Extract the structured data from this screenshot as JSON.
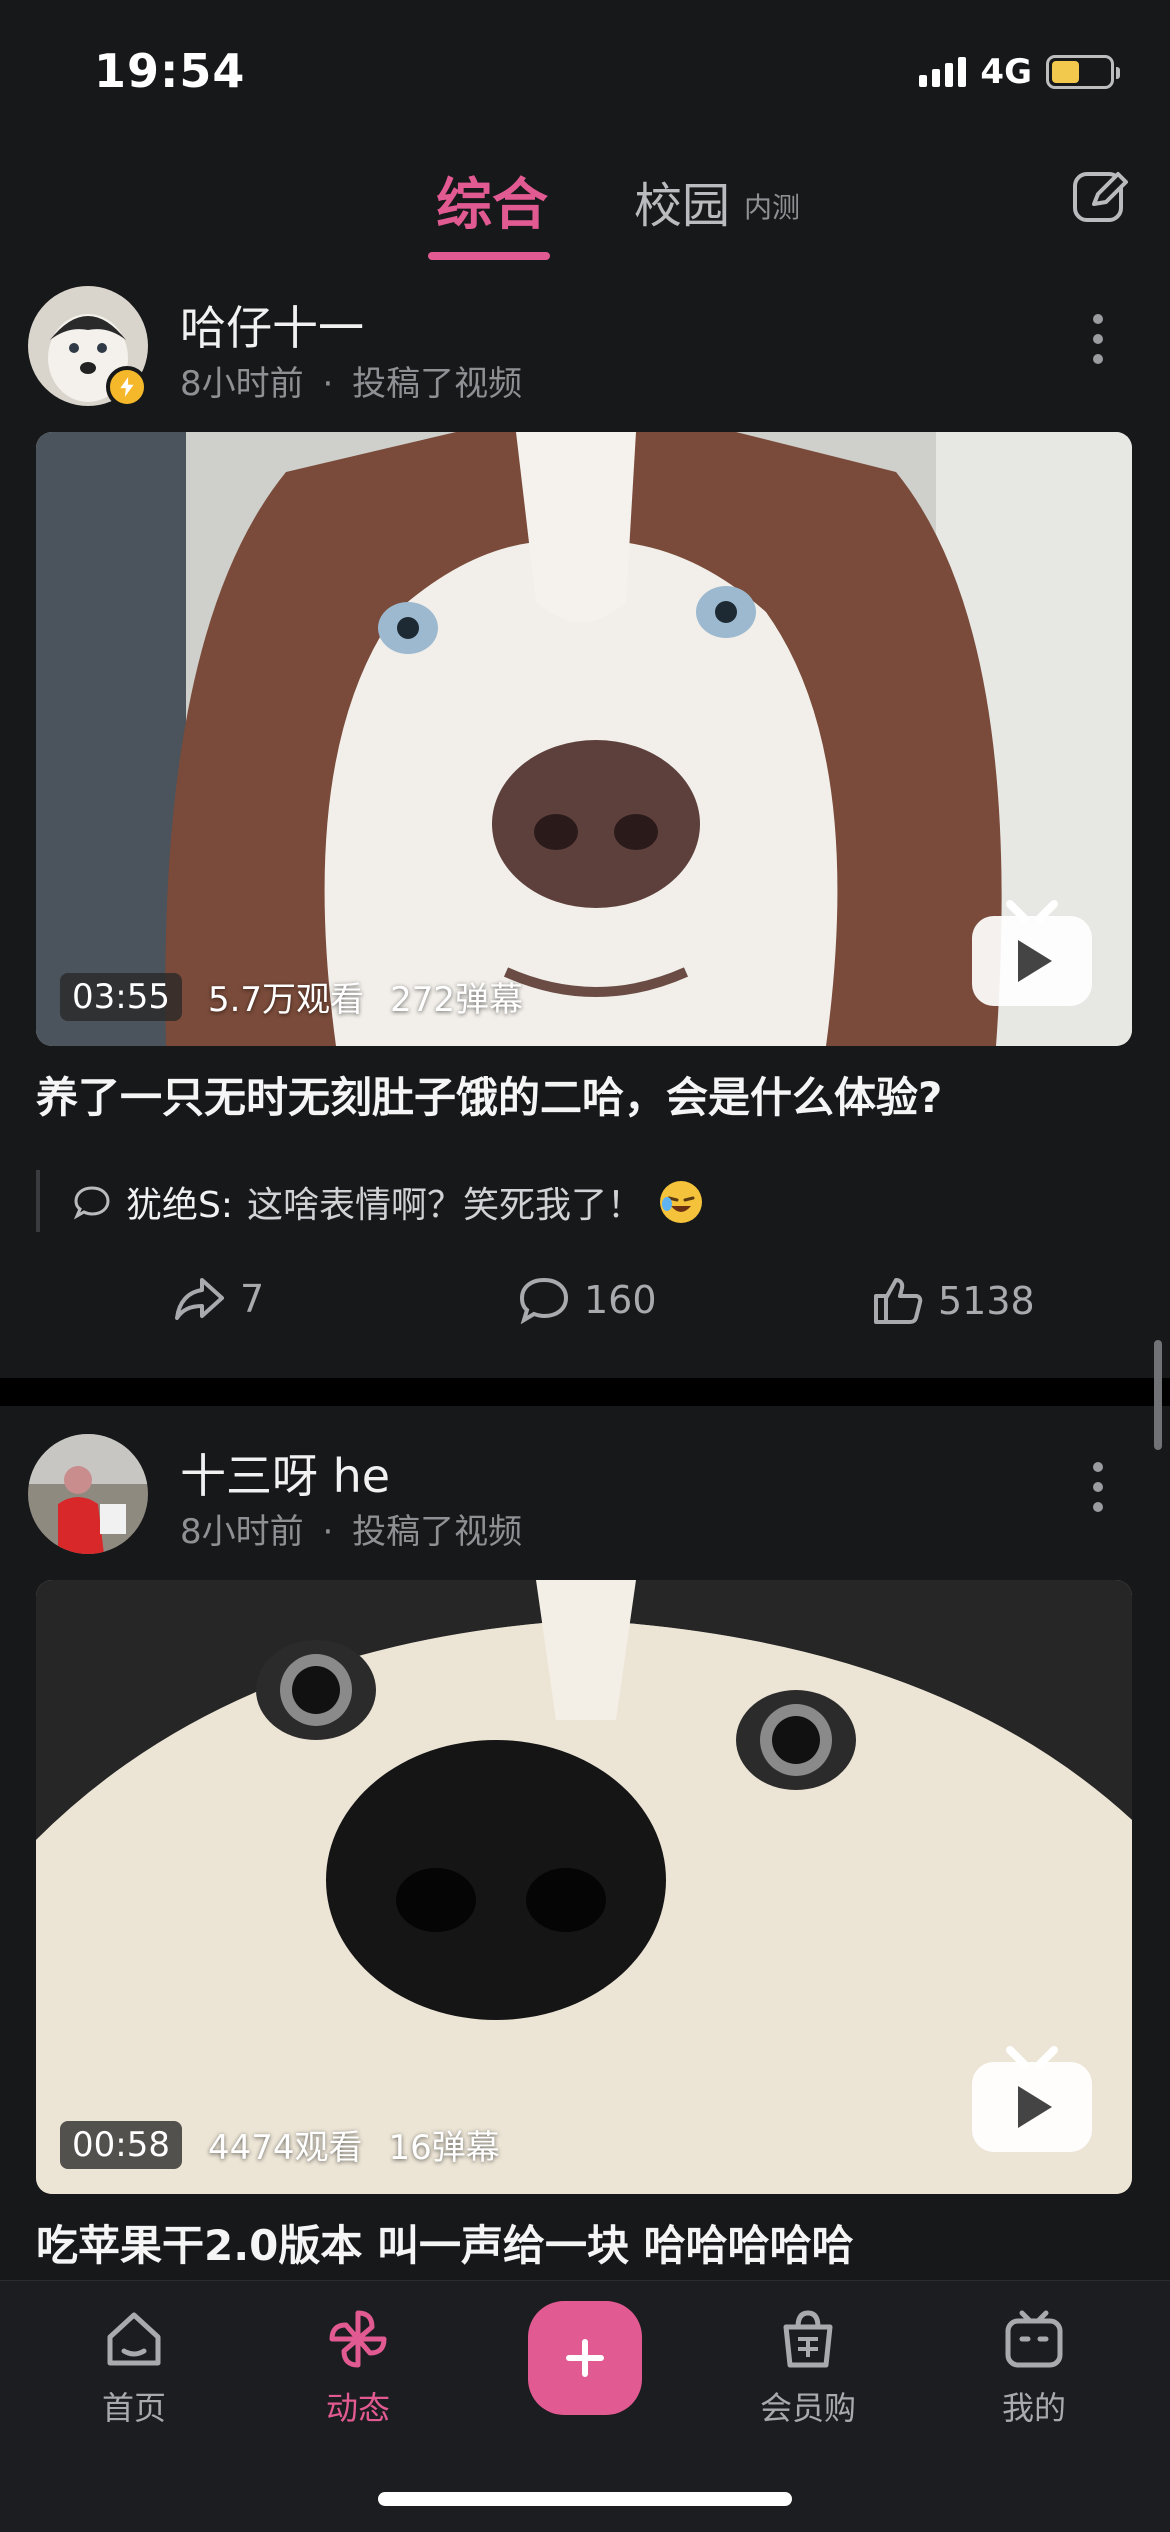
{
  "status_bar": {
    "time": "19:54",
    "network": "4G"
  },
  "top_tabs": {
    "active": "综合",
    "other": "校园",
    "other_badge": "内测"
  },
  "posts": [
    {
      "author": "哈仔十一",
      "time": "8小时前",
      "action": "投稿了视频",
      "duration": "03:55",
      "views": "5.7万观看",
      "danmaku": "272弹幕",
      "title": "养了一只无时无刻肚子饿的二哈，会是什么体验?",
      "comment_author": "犹绝S:",
      "comment_text": "这啥表情啊？笑死我了！",
      "shares": "7",
      "comments": "160",
      "likes": "5138"
    },
    {
      "author": "十三呀 he",
      "time": "8小时前",
      "action": "投稿了视频",
      "duration": "00:58",
      "views": "4474观看",
      "danmaku": "16弹幕",
      "title": "吃苹果干2.0版本 叫一声给一块 哈哈哈哈哈"
    }
  ],
  "meta_separator": "·",
  "bottom_nav": [
    {
      "label": "首页",
      "icon": "home-icon"
    },
    {
      "label": "动态",
      "icon": "pinwheel-icon",
      "active": true
    },
    {
      "label": "会员购",
      "icon": "shopping-bag-icon"
    },
    {
      "label": "我的",
      "icon": "tv-icon"
    }
  ],
  "colors": {
    "accent": "#e25a92",
    "background": "#17181a"
  }
}
